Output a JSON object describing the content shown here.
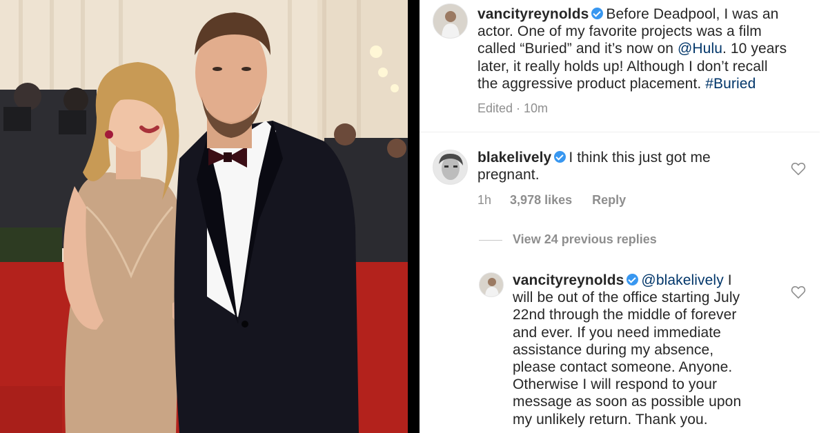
{
  "post": {
    "username": "vancityreynolds",
    "text_parts": [
      "Before Deadpool, I was an actor. One of my favorite projects was a film called “Buried” and it’s now on ",
      "@Hulu",
      ". 10 years later, it really holds up! Although I don’t recall the aggressive product placement. ",
      "#Buried"
    ],
    "line1": "Before Deadpool, I was an",
    "line2": "actor. One of my favorite projects was a film",
    "line3a": "called “Buried” and it’s now on ",
    "line3_mention": "@Hulu",
    "line3b": ". 10 years",
    "line4": "later, it really holds up! Although I don’t recall",
    "line5a": "the aggressive product placement. ",
    "line5_tag": "#Buried",
    "meta": "Edited · 10m"
  },
  "comment1": {
    "username": "blakelively",
    "line1": "I think this just got me",
    "line2": "pregnant.",
    "time": "1h",
    "likes": "3,978 likes",
    "reply_label": "Reply"
  },
  "view_replies": "View 24 previous replies",
  "reply": {
    "username": "vancityreynolds",
    "mention": "@blakelively",
    "line1_tail": " I",
    "lines": [
      "will be out of the office starting July",
      "22nd through the middle of forever",
      "and ever. If you need immediate",
      "assistance during my absence,",
      "please contact someone. Anyone.",
      "Otherwise I will respond to your",
      "message as soon as possible upon",
      "my unlikely return. Thank you."
    ]
  },
  "colors": {
    "verified": "#3897f0",
    "link": "#003569",
    "meta": "#8e8e8e",
    "carpet": "#b3221c",
    "tux": "#15151f"
  },
  "icons": [
    "verified-badge-icon",
    "heart-icon"
  ]
}
